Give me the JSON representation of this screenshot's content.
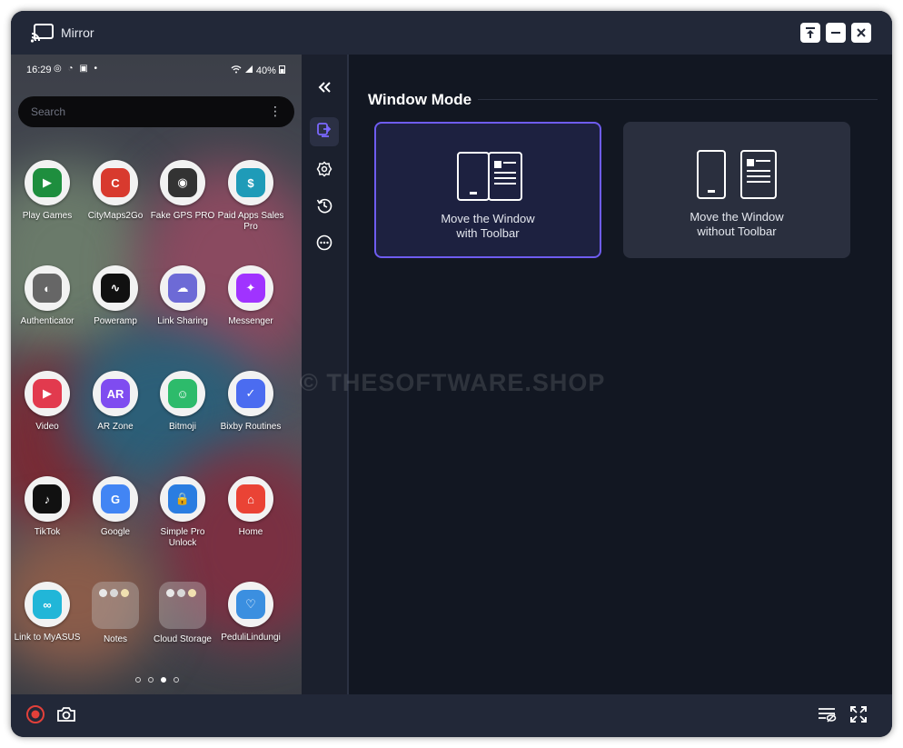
{
  "window": {
    "title": "Mirror",
    "accent_color": "#6e5cf0"
  },
  "titlebar_buttons": [
    {
      "icon": "pin-top-icon"
    },
    {
      "icon": "minimize-icon"
    },
    {
      "icon": "close-icon"
    }
  ],
  "phone": {
    "status": {
      "time": "16:29",
      "icons": "◎ ◔ ▣ •",
      "battery": "40%"
    },
    "search": {
      "placeholder": "Search",
      "more": "⋮"
    },
    "apps": [
      {
        "label": "Play Games",
        "icon": "play-games-icon",
        "color": "#1e8e3e"
      },
      {
        "label": "CityMaps2Go",
        "icon": "citymaps-icon",
        "color": "#d83a2e"
      },
      {
        "label": "Fake GPS PRO",
        "icon": "fake-gps-icon",
        "color": "#333333"
      },
      {
        "label": "Paid Apps Sales Pro",
        "icon": "paid-apps-icon",
        "color": "#1f9bb8"
      },
      {
        "label": "Authenticator",
        "icon": "authenticator-icon",
        "color": "#666666"
      },
      {
        "label": "Poweramp",
        "icon": "poweramp-icon",
        "color": "#111111"
      },
      {
        "label": "Link Sharing",
        "icon": "link-sharing-icon",
        "color": "#6d6ad6"
      },
      {
        "label": "Messenger",
        "icon": "messenger-icon",
        "color": "#a033ff"
      },
      {
        "label": "Video",
        "icon": "video-icon",
        "color": "#e23a4e"
      },
      {
        "label": "AR Zone",
        "icon": "ar-zone-icon",
        "color": "#7f4cf0"
      },
      {
        "label": "Bitmoji",
        "icon": "bitmoji-icon",
        "color": "#2dbb6b"
      },
      {
        "label": "Bixby Routines",
        "icon": "bixby-routines-icon",
        "color": "#4b6cf0"
      },
      {
        "label": "TikTok",
        "icon": "tiktok-icon",
        "color": "#111111"
      },
      {
        "label": "Google",
        "icon": "google-icon",
        "color": "#4285f4"
      },
      {
        "label": "Simple Pro Unlock",
        "icon": "simple-pro-unlock-icon",
        "color": "#2a7de1"
      },
      {
        "label": "Home",
        "icon": "google-home-icon",
        "color": "#ea4335"
      },
      {
        "label": "Link to MyASUS",
        "icon": "myasus-icon",
        "color": "#21b6d8"
      },
      {
        "label": "Notes",
        "icon": "notes-folder-icon",
        "color": "#888888"
      },
      {
        "label": "Cloud Storage",
        "icon": "cloud-storage-folder-icon",
        "color": "#888888"
      },
      {
        "label": "PeduliLindungi",
        "icon": "pedulilindungi-icon",
        "color": "#3b8fe0"
      }
    ],
    "page_indicator": {
      "count": 4,
      "active": 3
    }
  },
  "sidebar": {
    "collapse_icon": "double-chevron-left-icon",
    "items": [
      {
        "icon": "window-mode-icon",
        "active": true
      },
      {
        "icon": "settings-gear-icon",
        "active": false
      },
      {
        "icon": "history-icon",
        "active": false
      },
      {
        "icon": "more-circle-icon",
        "active": false
      }
    ]
  },
  "main": {
    "section_title": "Window Mode",
    "modes": [
      {
        "line1": "Move the Window",
        "line2": "with Toolbar",
        "selected": true
      },
      {
        "line1": "Move the Window",
        "line2": "without Toolbar",
        "selected": false
      }
    ],
    "watermark": "© THESOFTWARE.SHOP"
  },
  "bottombar": {
    "left": [
      {
        "icon": "record-icon",
        "color": "#e2403a"
      },
      {
        "icon": "screenshot-camera-icon"
      }
    ],
    "right": [
      {
        "icon": "hide-toolbar-icon"
      },
      {
        "icon": "fullscreen-icon"
      }
    ]
  }
}
